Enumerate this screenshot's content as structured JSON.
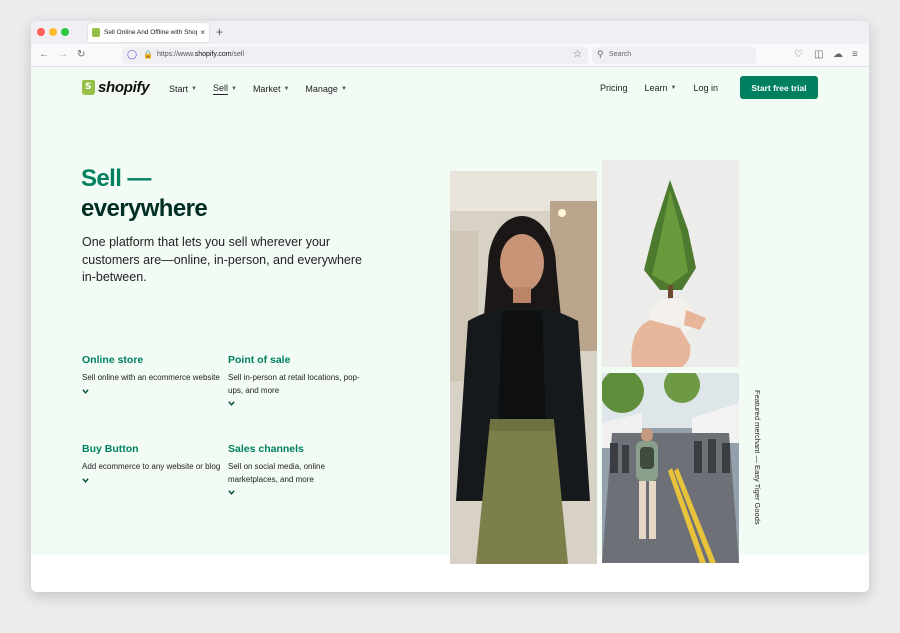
{
  "browser": {
    "tab_title": "Sell Online And Offline with Shopify",
    "tab_close": "×",
    "new_tab": "+",
    "url_prefix": "https://www.",
    "url_domain": "shopify.com",
    "url_path": "/sell",
    "search_placeholder": "Search"
  },
  "header": {
    "logo_text": "shopify",
    "nav_left": [
      {
        "label": "Start"
      },
      {
        "label": "Sell"
      },
      {
        "label": "Market"
      },
      {
        "label": "Manage"
      }
    ],
    "nav_right": [
      {
        "label": "Pricing"
      },
      {
        "label": "Learn"
      },
      {
        "label": "Log in"
      }
    ],
    "cta_label": "Start free trial"
  },
  "hero": {
    "title_line1": "Sell —",
    "title_line2": "everywhere",
    "lede": "One platform that lets you sell wherever your customers are—online, in-person, and everywhere in-between."
  },
  "features": [
    {
      "title": "Online store",
      "desc": "Sell online with an ecommerce website"
    },
    {
      "title": "Point of sale",
      "desc": "Sell in-person at retail locations, pop-ups, and more"
    },
    {
      "title": "Buy Button",
      "desc": "Add ecommerce to any website or blog"
    },
    {
      "title": "Sales channels",
      "desc": "Sell on social media, online marketplaces, and more"
    }
  ],
  "caption": "Featured merchant — Easy Tiger Goods",
  "colors": {
    "brand_green": "#008060",
    "dark_green": "#002e25",
    "hero_bg": "#f3fcf4",
    "logo_green": "#95bf47"
  }
}
